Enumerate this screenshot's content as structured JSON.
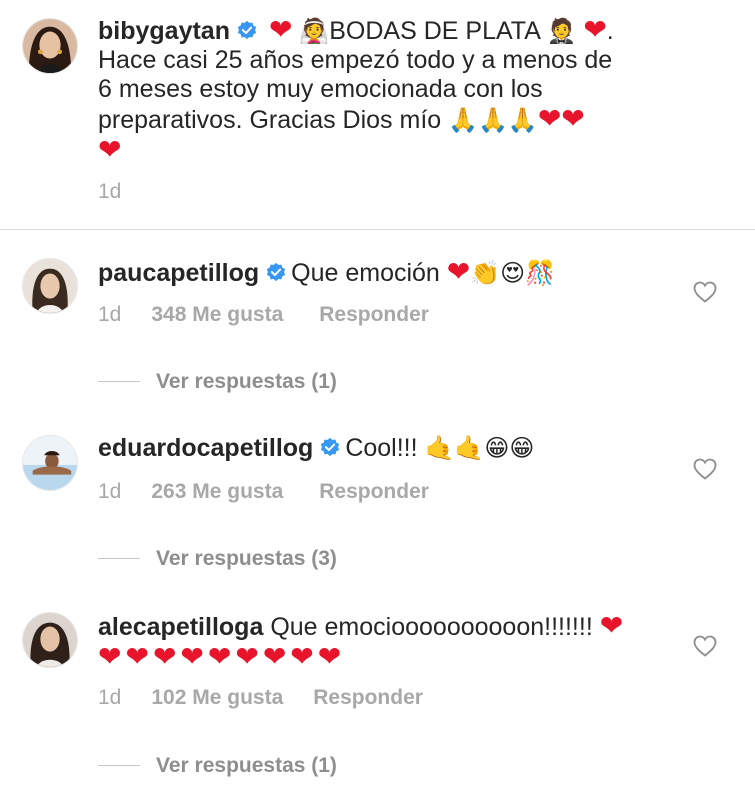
{
  "caption": {
    "username": "bibygaytan",
    "line1_after": "BODAS DE PLATA",
    "line2": "Hace casi 25 años empezó todo y a menos de",
    "line3": "6 meses estoy muy emocionada con los",
    "line4": "preparativos. Gracias Dios mío",
    "time": "1d",
    "emoji": {
      "heart": "❤",
      "bride": "👰",
      "groom": "🤵",
      "pray": "🙏",
      "dot": "."
    }
  },
  "comments": [
    {
      "username": "paucapetillog",
      "text": "Que emoción",
      "emojis": [
        "👏",
        "😍",
        "🎊"
      ],
      "time": "1d",
      "likes": "348 Me gusta",
      "reply": "Responder",
      "view_replies": "Ver respuestas (1)"
    },
    {
      "username": "eduardocapetillog",
      "text": "Cool!!!",
      "emojis": [
        "🤙",
        "🤙",
        "😁",
        "😁"
      ],
      "time": "1d",
      "likes": "263 Me gusta",
      "reply": "Responder",
      "view_replies": "Ver respuestas (3)"
    },
    {
      "username": "alecapetilloga",
      "text": "Que emocioooooooooon!!!!!!!",
      "time": "1d",
      "likes": "102 Me gusta",
      "reply": "Responder",
      "view_replies": "Ver respuestas (1)"
    }
  ],
  "colors": {
    "heart_red": "#e8142b",
    "verified_blue": "#3897f0",
    "muted": "#a8a8a8"
  },
  "icons": {
    "verified": "verified-badge-icon",
    "like": "heart-outline-icon"
  }
}
